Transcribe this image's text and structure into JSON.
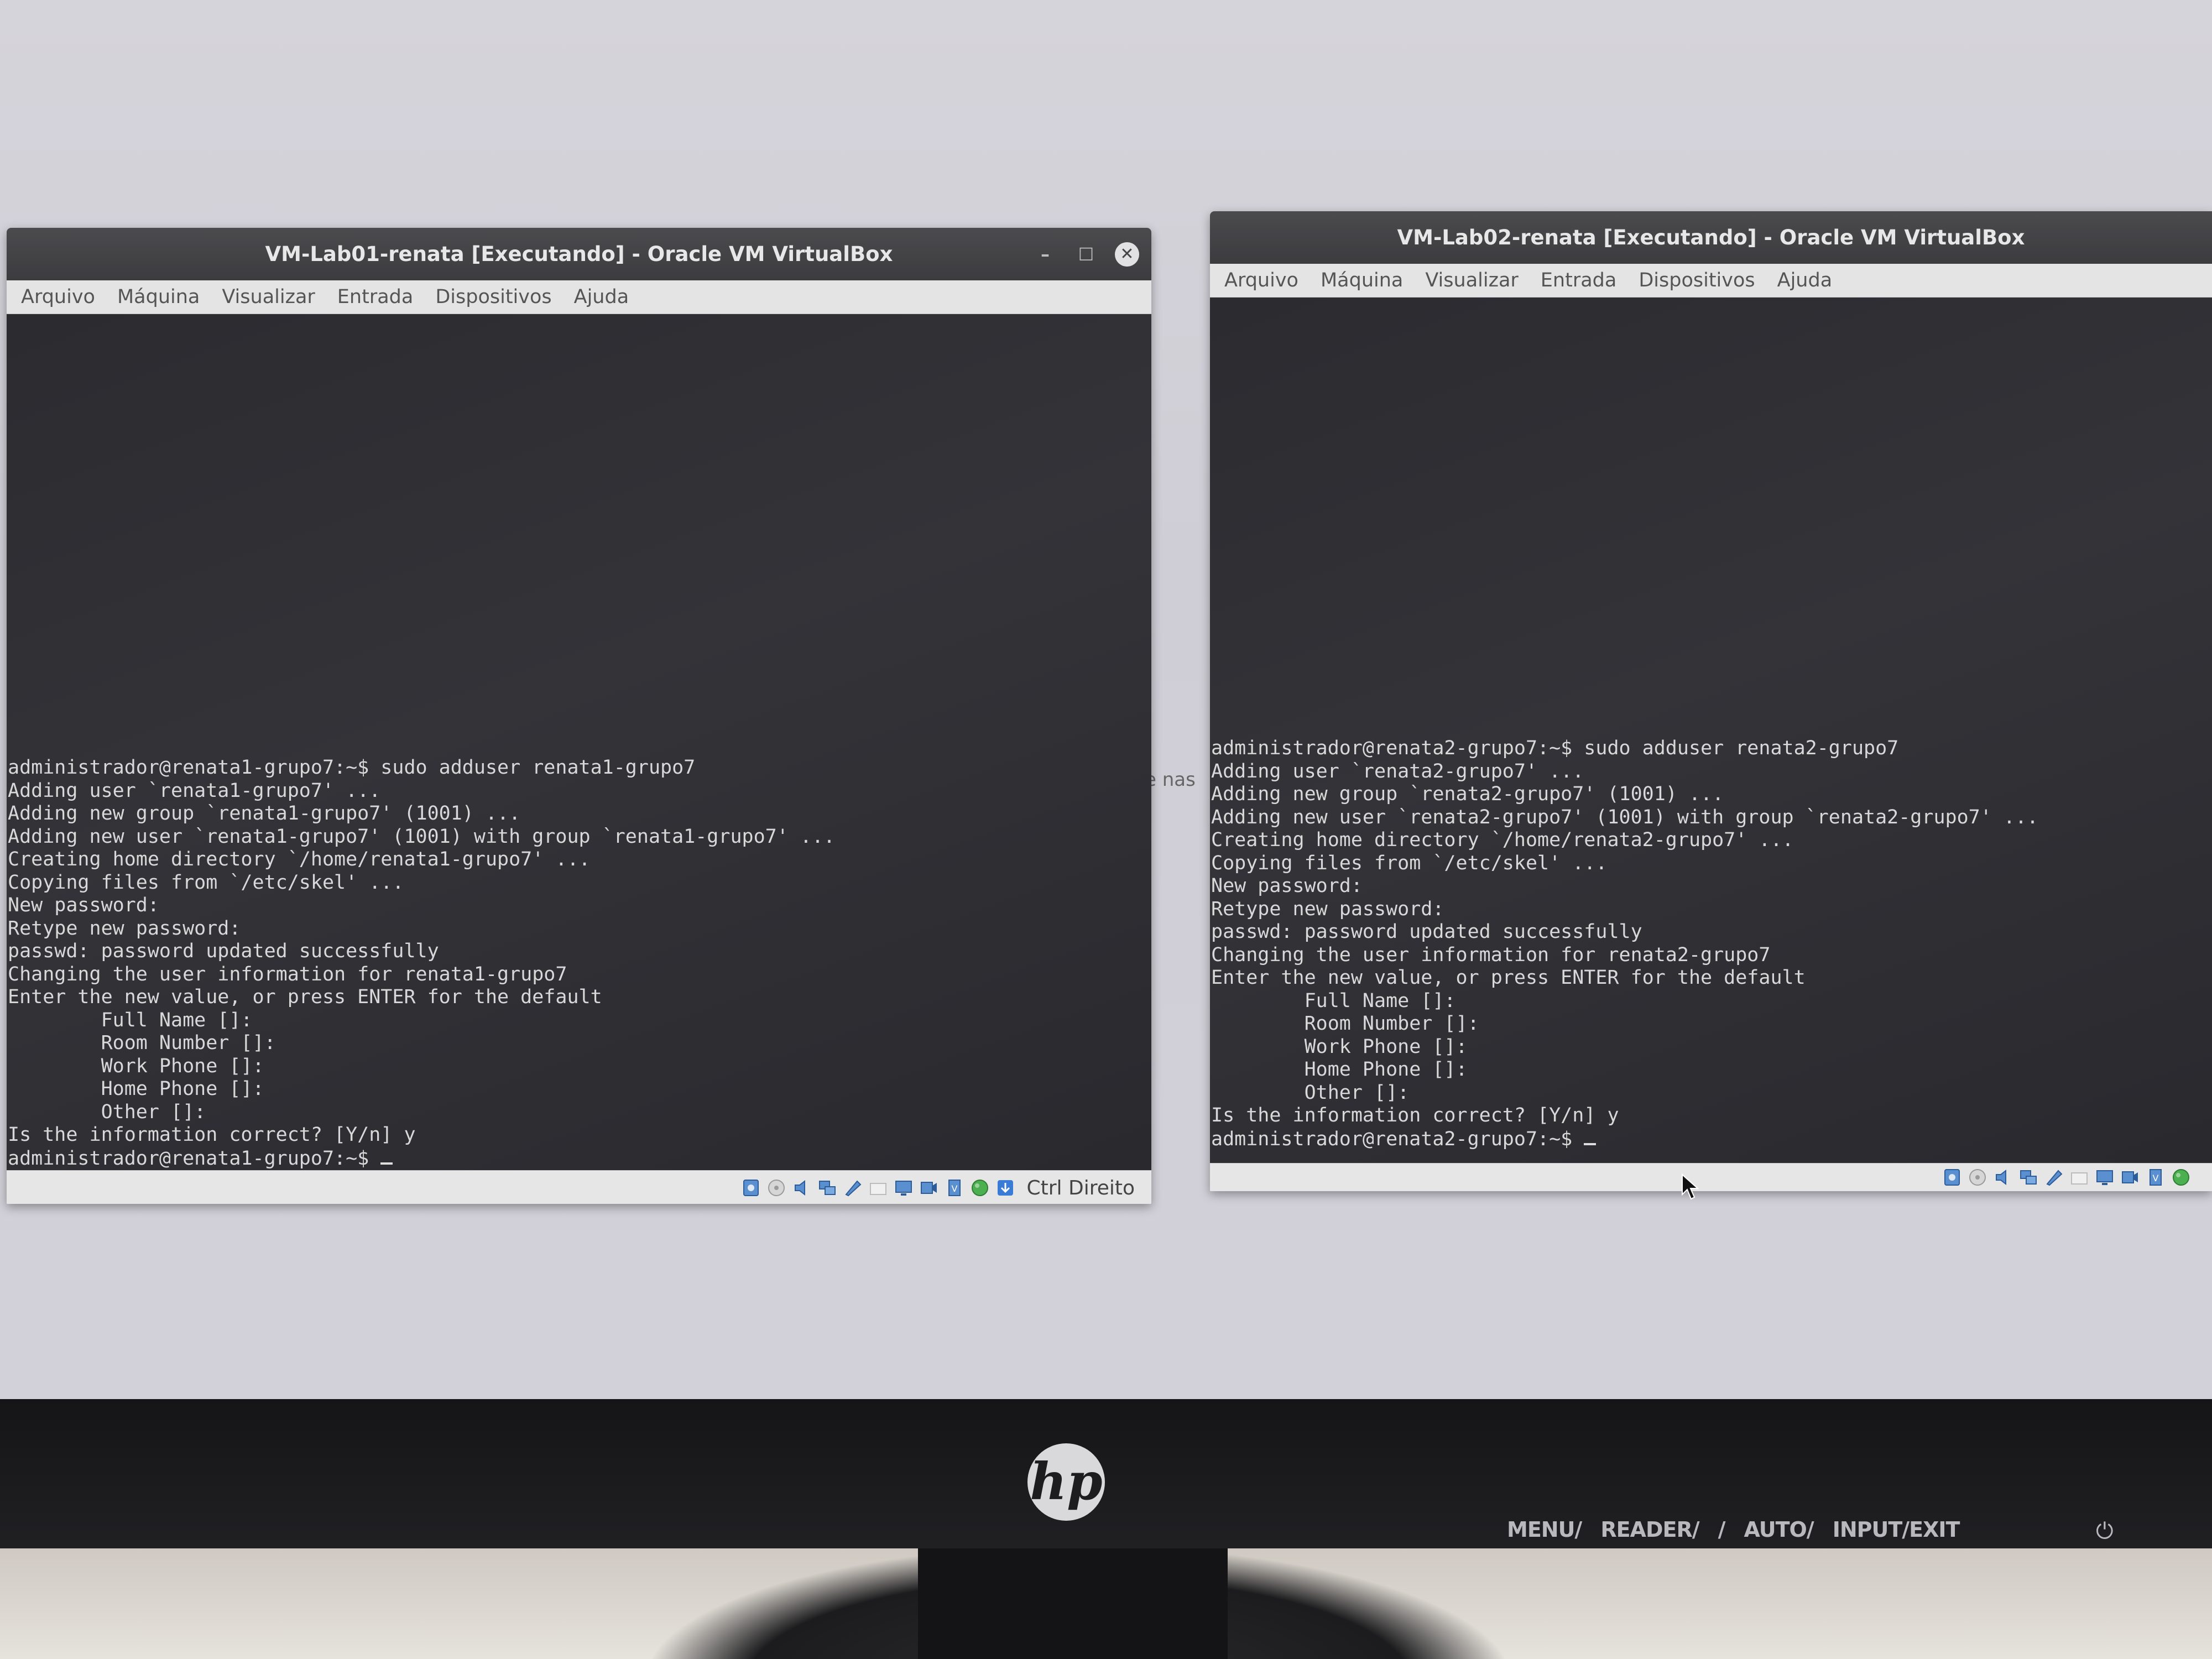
{
  "screen": {
    "desktop_fragment": "e nas"
  },
  "vm1": {
    "title": "VM-Lab01-renata [Executando] - Oracle VM VirtualBox",
    "menu": [
      "Arquivo",
      "Máquina",
      "Visualizar",
      "Entrada",
      "Dispositivos",
      "Ajuda"
    ],
    "terminal_lines": [
      "administrador@renata1-grupo7:~$ sudo adduser renata1-grupo7",
      "Adding user `renata1-grupo7' ...",
      "Adding new group `renata1-grupo7' (1001) ...",
      "Adding new user `renata1-grupo7' (1001) with group `renata1-grupo7' ...",
      "Creating home directory `/home/renata1-grupo7' ...",
      "Copying files from `/etc/skel' ...",
      "New password:",
      "Retype new password:",
      "passwd: password updated successfully",
      "Changing the user information for renata1-grupo7",
      "Enter the new value, or press ENTER for the default",
      "        Full Name []:",
      "        Room Number []:",
      "        Work Phone []:",
      "        Home Phone []:",
      "        Other []:",
      "Is the information correct? [Y/n] y",
      "administrador@renata1-grupo7:~$ "
    ],
    "status_label": "Ctrl Direito"
  },
  "vm2": {
    "title": "VM-Lab02-renata [Executando] - Oracle VM VirtualBox",
    "menu": [
      "Arquivo",
      "Máquina",
      "Visualizar",
      "Entrada",
      "Dispositivos",
      "Ajuda"
    ],
    "terminal_lines": [
      "administrador@renata2-grupo7:~$ sudo adduser renata2-grupo7",
      "Adding user `renata2-grupo7' ...",
      "Adding new group `renata2-grupo7' (1001) ...",
      "Adding new user `renata2-grupo7' (1001) with group `renata2-grupo7' ...",
      "Creating home directory `/home/renata2-grupo7' ...",
      "Copying files from `/etc/skel' ...",
      "New password:",
      "Retype new password:",
      "passwd: password updated successfully",
      "Changing the user information for renata2-grupo7",
      "Enter the new value, or press ENTER for the default",
      "        Full Name []:",
      "        Room Number []:",
      "        Work Phone []:",
      "        Home Phone []:",
      "        Other []:",
      "Is the information correct? [Y/n] y",
      "administrador@renata2-grupo7:~$ "
    ]
  },
  "monitor": {
    "brand": "hp",
    "controls": [
      "MENU/",
      "READER/",
      "/",
      "AUTO/",
      "INPUT/EXIT"
    ]
  },
  "icons": {
    "status_icons": [
      "hard-disk-icon",
      "optical-drive-icon",
      "audio-icon",
      "network-icon",
      "usb-icon",
      "shared-folder-icon",
      "display-icon",
      "video-capture-icon",
      "cpu-icon",
      "guest-additions-icon",
      "mouse-integration-icon"
    ],
    "window_controls": [
      "minimize-icon",
      "maximize-icon",
      "close-icon"
    ]
  },
  "colors": {
    "titlebar": "#3f3e41",
    "terminal_bg": "#2f2f34",
    "terminal_fg": "#d8d8d8",
    "desktop_bg": "#d3d1d9"
  }
}
